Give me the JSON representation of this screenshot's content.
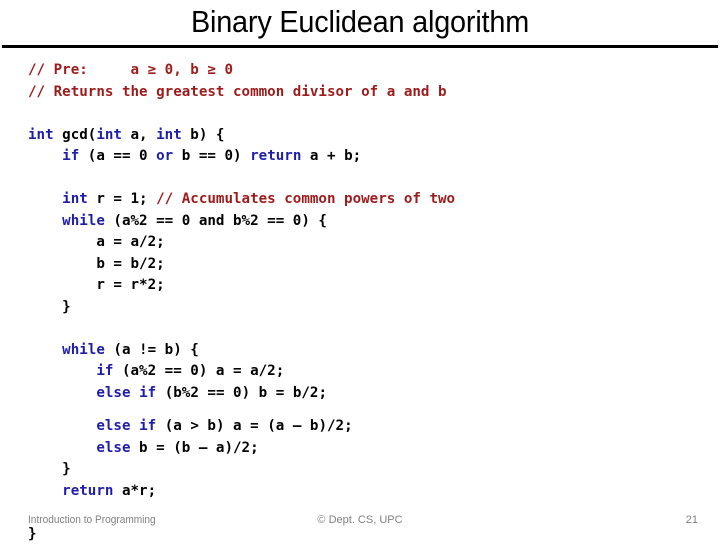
{
  "slide": {
    "title": "Binary Euclidean algorithm",
    "colors": {
      "keyword": "#1e1eaa",
      "comment": "#9e1b1b",
      "identifier": "#000000",
      "rule": "#000000",
      "footer_text": "#808080",
      "background": "#ffffff"
    }
  },
  "code": {
    "language": "C++",
    "lines": [
      {
        "indent": 0,
        "spans": [
          {
            "text": "// Pre:     a ≥ 0, b ≥ 0",
            "type": "comment"
          }
        ]
      },
      {
        "indent": 0,
        "spans": [
          {
            "text": "// Returns the greatest common divisor of a and b",
            "type": "comment"
          }
        ]
      },
      {
        "blank": true
      },
      {
        "indent": 0,
        "spans": [
          {
            "text": "int",
            "type": "keyword"
          },
          {
            "text": " gcd(",
            "type": "identifier"
          },
          {
            "text": "int",
            "type": "keyword"
          },
          {
            "text": " a, ",
            "type": "identifier"
          },
          {
            "text": "int",
            "type": "keyword"
          },
          {
            "text": " b) {",
            "type": "identifier"
          }
        ]
      },
      {
        "indent": 4,
        "spans": [
          {
            "text": "if",
            "type": "keyword"
          },
          {
            "text": " (a == 0 ",
            "type": "identifier"
          },
          {
            "text": "or",
            "type": "keyword"
          },
          {
            "text": " b == 0) ",
            "type": "identifier"
          },
          {
            "text": "return",
            "type": "keyword"
          },
          {
            "text": " a + b;",
            "type": "identifier"
          }
        ]
      },
      {
        "blank": true
      },
      {
        "indent": 4,
        "spans": [
          {
            "text": "int",
            "type": "keyword"
          },
          {
            "text": " r = 1; ",
            "type": "identifier"
          },
          {
            "text": "// Accumulates common powers of two",
            "type": "comment"
          }
        ]
      },
      {
        "indent": 4,
        "spans": [
          {
            "text": "while",
            "type": "keyword"
          },
          {
            "text": " (a%2 == 0 and b%2 == 0) {",
            "type": "identifier"
          }
        ]
      },
      {
        "indent": 8,
        "spans": [
          {
            "text": "a = a/2;",
            "type": "identifier"
          }
        ]
      },
      {
        "indent": 8,
        "spans": [
          {
            "text": "b = b/2;",
            "type": "identifier"
          }
        ]
      },
      {
        "indent": 8,
        "spans": [
          {
            "text": "r = r*2;",
            "type": "identifier"
          }
        ]
      },
      {
        "indent": 4,
        "spans": [
          {
            "text": "}",
            "type": "identifier"
          }
        ]
      },
      {
        "blank": true
      },
      {
        "indent": 4,
        "spans": [
          {
            "text": "while",
            "type": "keyword"
          },
          {
            "text": " (a != b) {",
            "type": "identifier"
          }
        ]
      },
      {
        "indent": 8,
        "spans": [
          {
            "text": "if",
            "type": "keyword"
          },
          {
            "text": " (a%2 == 0) a = a/2;",
            "type": "identifier"
          }
        ]
      },
      {
        "indent": 8,
        "spans": [
          {
            "text": "else",
            "type": "keyword"
          },
          {
            "text": " ",
            "type": "identifier"
          },
          {
            "text": "if",
            "type": "keyword"
          },
          {
            "text": " (b%2 == 0) b = b/2;",
            "type": "identifier"
          }
        ]
      },
      {
        "gap": true
      },
      {
        "indent": 8,
        "spans": [
          {
            "text": "else",
            "type": "keyword"
          },
          {
            "text": " ",
            "type": "identifier"
          },
          {
            "text": "if",
            "type": "keyword"
          },
          {
            "text": " (a > b) a = (a – b)/2;",
            "type": "identifier"
          }
        ]
      },
      {
        "indent": 8,
        "spans": [
          {
            "text": "else",
            "type": "keyword"
          },
          {
            "text": " b = (b – a)/2;",
            "type": "identifier"
          }
        ]
      },
      {
        "indent": 4,
        "spans": [
          {
            "text": "}",
            "type": "identifier"
          }
        ]
      },
      {
        "indent": 4,
        "spans": [
          {
            "text": "return",
            "type": "keyword"
          },
          {
            "text": " a*r;",
            "type": "identifier"
          }
        ]
      },
      {
        "blank": true
      },
      {
        "indent": 0,
        "spans": [
          {
            "text": "}",
            "type": "identifier"
          }
        ]
      }
    ]
  },
  "footer": {
    "left": "Introduction to Programming",
    "center": "© Dept. CS, UPC",
    "page_number": "21"
  }
}
